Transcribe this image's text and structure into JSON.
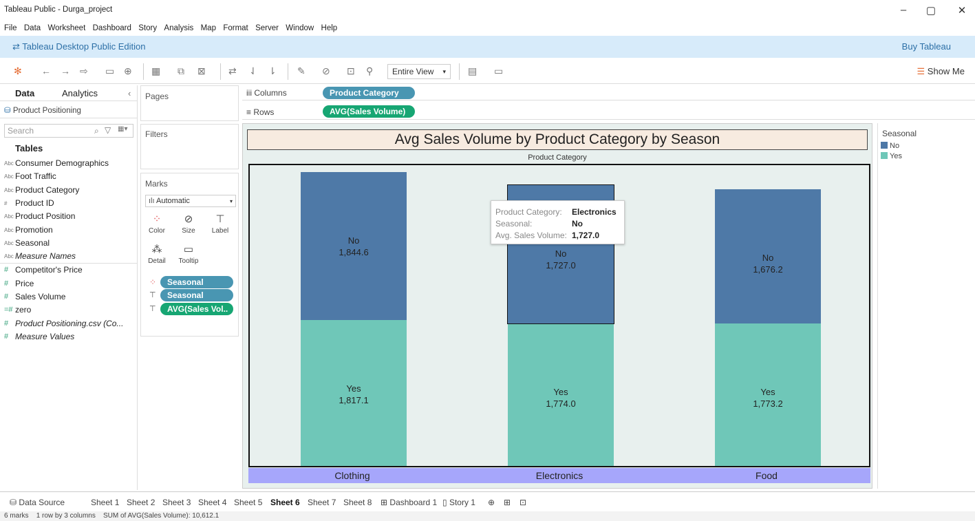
{
  "window": {
    "title": "Tableau Public - Durga_project",
    "minimize": "–",
    "restore": "▢",
    "close": "✕"
  },
  "menu": [
    "File",
    "Data",
    "Worksheet",
    "Dashboard",
    "Story",
    "Analysis",
    "Map",
    "Format",
    "Server",
    "Window",
    "Help"
  ],
  "edition": {
    "label": "Tableau Desktop Public Edition",
    "buy": "Buy Tableau"
  },
  "toolbar": {
    "fit_mode": "Entire View",
    "show_me": "Show Me"
  },
  "datapane": {
    "tabs": [
      "Data",
      "Analytics"
    ],
    "datasource": "Product Positioning",
    "search_placeholder": "Search",
    "tables_heading": "Tables",
    "dimensions": [
      {
        "icon": "Abc",
        "name": "Consumer Demographics"
      },
      {
        "icon": "Abc",
        "name": "Foot Traffic"
      },
      {
        "icon": "Abc",
        "name": "Product Category"
      },
      {
        "icon": "#",
        "name": "Product ID"
      },
      {
        "icon": "Abc",
        "name": "Product Position"
      },
      {
        "icon": "Abc",
        "name": "Promotion"
      },
      {
        "icon": "Abc",
        "name": "Seasonal"
      },
      {
        "icon": "Abc",
        "name": "Measure Names"
      }
    ],
    "measures": [
      {
        "icon": "#",
        "name": "Competitor's Price"
      },
      {
        "icon": "#",
        "name": "Price"
      },
      {
        "icon": "#",
        "name": "Sales Volume"
      },
      {
        "icon": "=#",
        "name": "zero"
      },
      {
        "icon": "#",
        "name": "Product Positioning.csv (Co..."
      },
      {
        "icon": "#",
        "name": "Measure Values"
      }
    ]
  },
  "shelves": {
    "pages": "Pages",
    "filters": "Filters",
    "marks": "Marks",
    "mark_type": "Automatic",
    "mark_buttons": [
      "Color",
      "Size",
      "Label",
      "Detail",
      "Tooltip"
    ],
    "mark_pills": [
      "Seasonal",
      "Seasonal",
      "AVG(Sales Vol.."
    ],
    "columns_label": "Columns",
    "columns_pill": "Product Category",
    "rows_label": "Rows",
    "rows_pill": "AVG(Sales Volume)"
  },
  "legend": {
    "title": "Seasonal",
    "items": [
      {
        "label": "No",
        "color": "#4e79a7"
      },
      {
        "label": "Yes",
        "color": "#6fc7b8"
      }
    ]
  },
  "chart_data": {
    "type": "bar",
    "stacked": true,
    "title": "Avg Sales Volume by Product Category by Season",
    "header": "Product Category",
    "categories": [
      "Clothing",
      "Electronics",
      "Food"
    ],
    "series": [
      {
        "name": "Yes",
        "color": "#6fc7b8",
        "values": [
          1817.1,
          1774.0,
          1773.2
        ],
        "labels": [
          "1,817.1",
          "1,774.0",
          "1,773.2"
        ]
      },
      {
        "name": "No",
        "color": "#4e79a7",
        "values": [
          1844.6,
          1727.0,
          1676.2
        ],
        "labels": [
          "1,844.6",
          "1,727.0",
          "1,676.2"
        ]
      }
    ],
    "ylim": [
      0,
      3750
    ]
  },
  "tooltip": {
    "rows": [
      {
        "key": "Product Category:",
        "value": "Electronics"
      },
      {
        "key": "Seasonal:",
        "value": "No"
      },
      {
        "key": "Avg. Sales Volume:",
        "value": "1,727.0"
      }
    ]
  },
  "sheettabs": {
    "datasource": "Data Source",
    "sheets": [
      "Sheet 1",
      "Sheet 2",
      "Sheet 3",
      "Sheet 4",
      "Sheet 5",
      "Sheet 6",
      "Sheet 7",
      "Sheet 8",
      "Dashboard 1",
      "Story 1"
    ],
    "active": "Sheet 6"
  },
  "status": {
    "marks": "6 marks",
    "layout": "1 row by 3 columns",
    "sum": "SUM of AVG(Sales Volume): 10,612.1"
  }
}
